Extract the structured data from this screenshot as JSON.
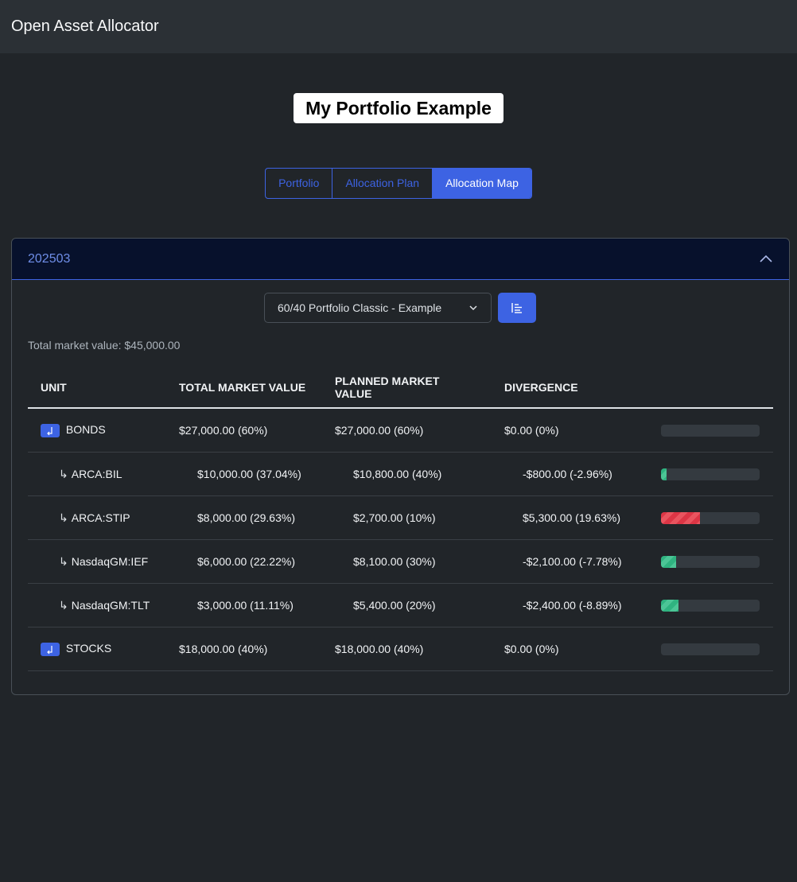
{
  "app": {
    "title": "Open Asset Allocator"
  },
  "page": {
    "title": "My Portfolio Example"
  },
  "tabs": [
    {
      "label": "Portfolio",
      "active": false
    },
    {
      "label": "Allocation Plan",
      "active": false
    },
    {
      "label": "Allocation Map",
      "active": true
    }
  ],
  "accordion": {
    "title": "202503",
    "expanded": true
  },
  "plan_select": {
    "value": "60/40 Portfolio Classic - Example"
  },
  "total_market_value": "Total market value: $45,000.00",
  "table": {
    "headers": [
      "UNIT",
      "TOTAL MARKET VALUE",
      "PLANNED MARKET VALUE",
      "DIVERGENCE"
    ],
    "rows": [
      {
        "unit": "BONDS",
        "type": "group",
        "total": "$27,000.00 (60%)",
        "planned": "$27,000.00 (60%)",
        "divergence": "$0.00 (0%)",
        "bar_fraction": 0,
        "bar_color": "none"
      },
      {
        "unit": "ARCA:BIL",
        "type": "child",
        "total": "$10,000.00 (37.04%)",
        "planned": "$10,800.00 (40%)",
        "divergence": "-$800.00 (-2.96%)",
        "bar_fraction": 0.0296,
        "bar_color": "green"
      },
      {
        "unit": "ARCA:STIP",
        "type": "child",
        "total": "$8,000.00 (29.63%)",
        "planned": "$2,700.00 (10%)",
        "divergence": "$5,300.00 (19.63%)",
        "bar_fraction": 0.1963,
        "bar_color": "red"
      },
      {
        "unit": "NasdaqGM:IEF",
        "type": "child",
        "total": "$6,000.00 (22.22%)",
        "planned": "$8,100.00 (30%)",
        "divergence": "-$2,100.00 (-7.78%)",
        "bar_fraction": 0.0778,
        "bar_color": "green"
      },
      {
        "unit": "NasdaqGM:TLT",
        "type": "child",
        "total": "$3,000.00 (11.11%)",
        "planned": "$5,400.00 (20%)",
        "divergence": "-$2,400.00 (-8.89%)",
        "bar_fraction": 0.0889,
        "bar_color": "green"
      },
      {
        "unit": "STOCKS",
        "type": "group",
        "total": "$18,000.00 (40%)",
        "planned": "$18,000.00 (40%)",
        "divergence": "$0.00 (0%)",
        "bar_fraction": 0,
        "bar_color": "none"
      }
    ]
  },
  "colors": {
    "accent": "#3d63e3",
    "positive_bar": "#2fb380",
    "negative_bar": "#dc3545"
  }
}
